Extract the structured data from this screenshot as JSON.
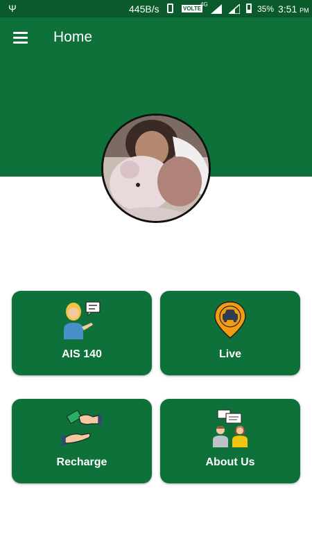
{
  "status_bar": {
    "speed": "445B/s",
    "volte": "VOLTE",
    "network": "4G",
    "battery_percent": "35%",
    "time": "3:51",
    "ampm": "PM"
  },
  "app_bar": {
    "title": "Home"
  },
  "tiles": [
    {
      "label": "AIS 140",
      "icon": "person-chat-icon"
    },
    {
      "label": "Live",
      "icon": "car-location-pin-icon"
    },
    {
      "label": "Recharge",
      "icon": "hands-money-icon"
    },
    {
      "label": "About Us",
      "icon": "people-meeting-icon"
    }
  ],
  "colors": {
    "primary": "#0f713a",
    "status_bar": "#0a5a2c"
  }
}
